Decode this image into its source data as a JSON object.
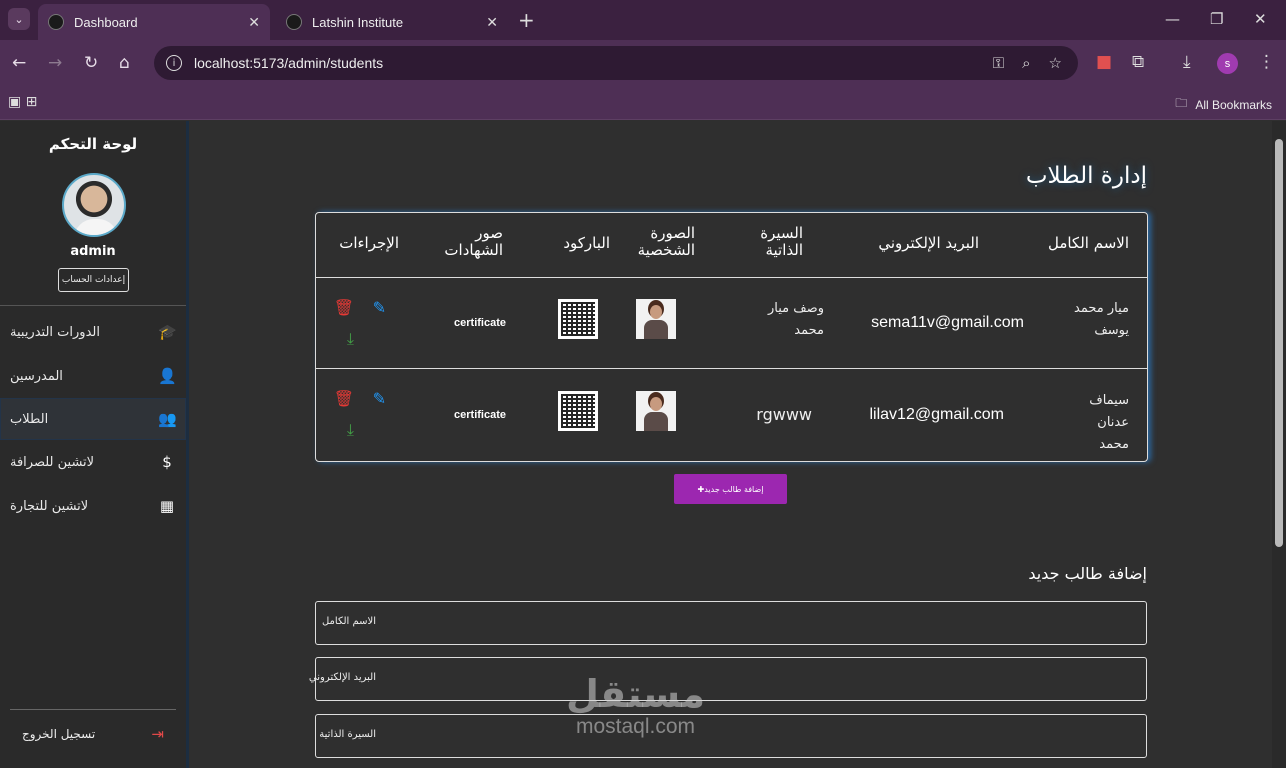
{
  "browser": {
    "tabs": [
      {
        "title": "Dashboard",
        "active": true
      },
      {
        "title": "Latshin Institute",
        "active": false
      }
    ],
    "url": "localhost:5173/admin/students",
    "profile_initial": "s",
    "bookmarks_label": "All Bookmarks"
  },
  "sidebar": {
    "title": "لوحة التحكم",
    "username": "admin",
    "settings_label": "إعدادات الحساب",
    "items": [
      {
        "label": "الدورات التدريبية",
        "icon": "graduation-cap-icon"
      },
      {
        "label": "المدرسين",
        "icon": "person-icon"
      },
      {
        "label": "الطلاب",
        "icon": "group-icon"
      },
      {
        "label": "لاتشين للصرافة",
        "icon": "currency-exchange-icon"
      },
      {
        "label": "لاتشين للتجارة",
        "icon": "business-building-icon"
      }
    ],
    "logout_label": "تسجيل الخروج"
  },
  "main": {
    "title": "إدارة الطلاب",
    "columns": [
      "الاسم الكامل",
      "البريد الإلكتروني",
      "السيرة الذاتية",
      "الصورة الشخصية",
      "الباركود",
      "صور الشهادات",
      "الإجراءات"
    ],
    "students": [
      {
        "name": "ميار محمد يوسف",
        "email": "sema11v@gmail.com",
        "bio": "وصف ميار محمد",
        "certificate": "certificate"
      },
      {
        "name": "سيماف عدنان محمد",
        "email": "lilav12@gmail.com",
        "bio": "rgwww",
        "certificate": "certificate"
      }
    ],
    "add_button": "إضافة طالب جديد",
    "form": {
      "title": "إضافة طالب جديد",
      "fields": [
        "الاسم الكامل",
        "البريد الإلكتروني",
        "السيرة الذاتية"
      ]
    }
  },
  "watermark": {
    "arabic": "مستقل",
    "latin": "mostaql.com"
  },
  "colors": {
    "accent_purple": "#9c27b0",
    "delete": "#e53935",
    "edit": "#2196f3",
    "download": "#43a047",
    "chrome": "#4e2f55"
  }
}
